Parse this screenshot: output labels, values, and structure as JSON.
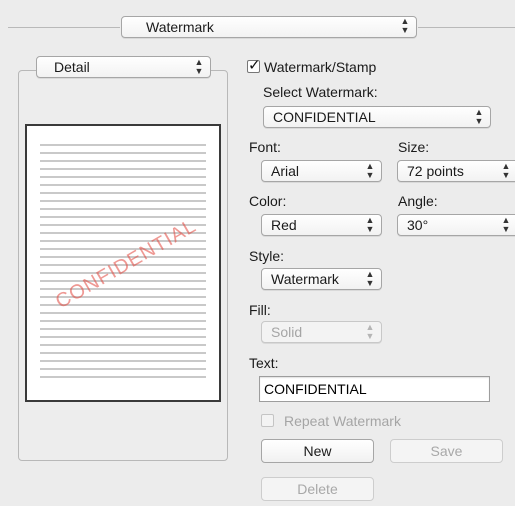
{
  "top_popup": {
    "label": "Watermark"
  },
  "left_panel": {
    "view_popup": {
      "label": "Detail"
    }
  },
  "preview": {
    "stamp_text": "CONFIDENTIAL",
    "stamp_color": "#e1463c"
  },
  "watermark_stamp": {
    "label": "Watermark/Stamp",
    "checked": true
  },
  "select_watermark": {
    "label": "Select Watermark:",
    "value": "CONFIDENTIAL"
  },
  "font": {
    "label": "Font:",
    "value": "Arial"
  },
  "size": {
    "label": "Size:",
    "value": "72 points"
  },
  "color": {
    "label": "Color:",
    "value": "Red"
  },
  "angle": {
    "label": "Angle:",
    "value": "30°"
  },
  "style": {
    "label": "Style:",
    "value": "Watermark"
  },
  "fill": {
    "label": "Fill:",
    "value": "Solid",
    "disabled": true
  },
  "text": {
    "label": "Text:",
    "value": "CONFIDENTIAL"
  },
  "repeat_watermark": {
    "label": "Repeat Watermark",
    "checked": false,
    "disabled": true
  },
  "buttons": {
    "new": "New",
    "save": "Save",
    "delete": "Delete"
  }
}
